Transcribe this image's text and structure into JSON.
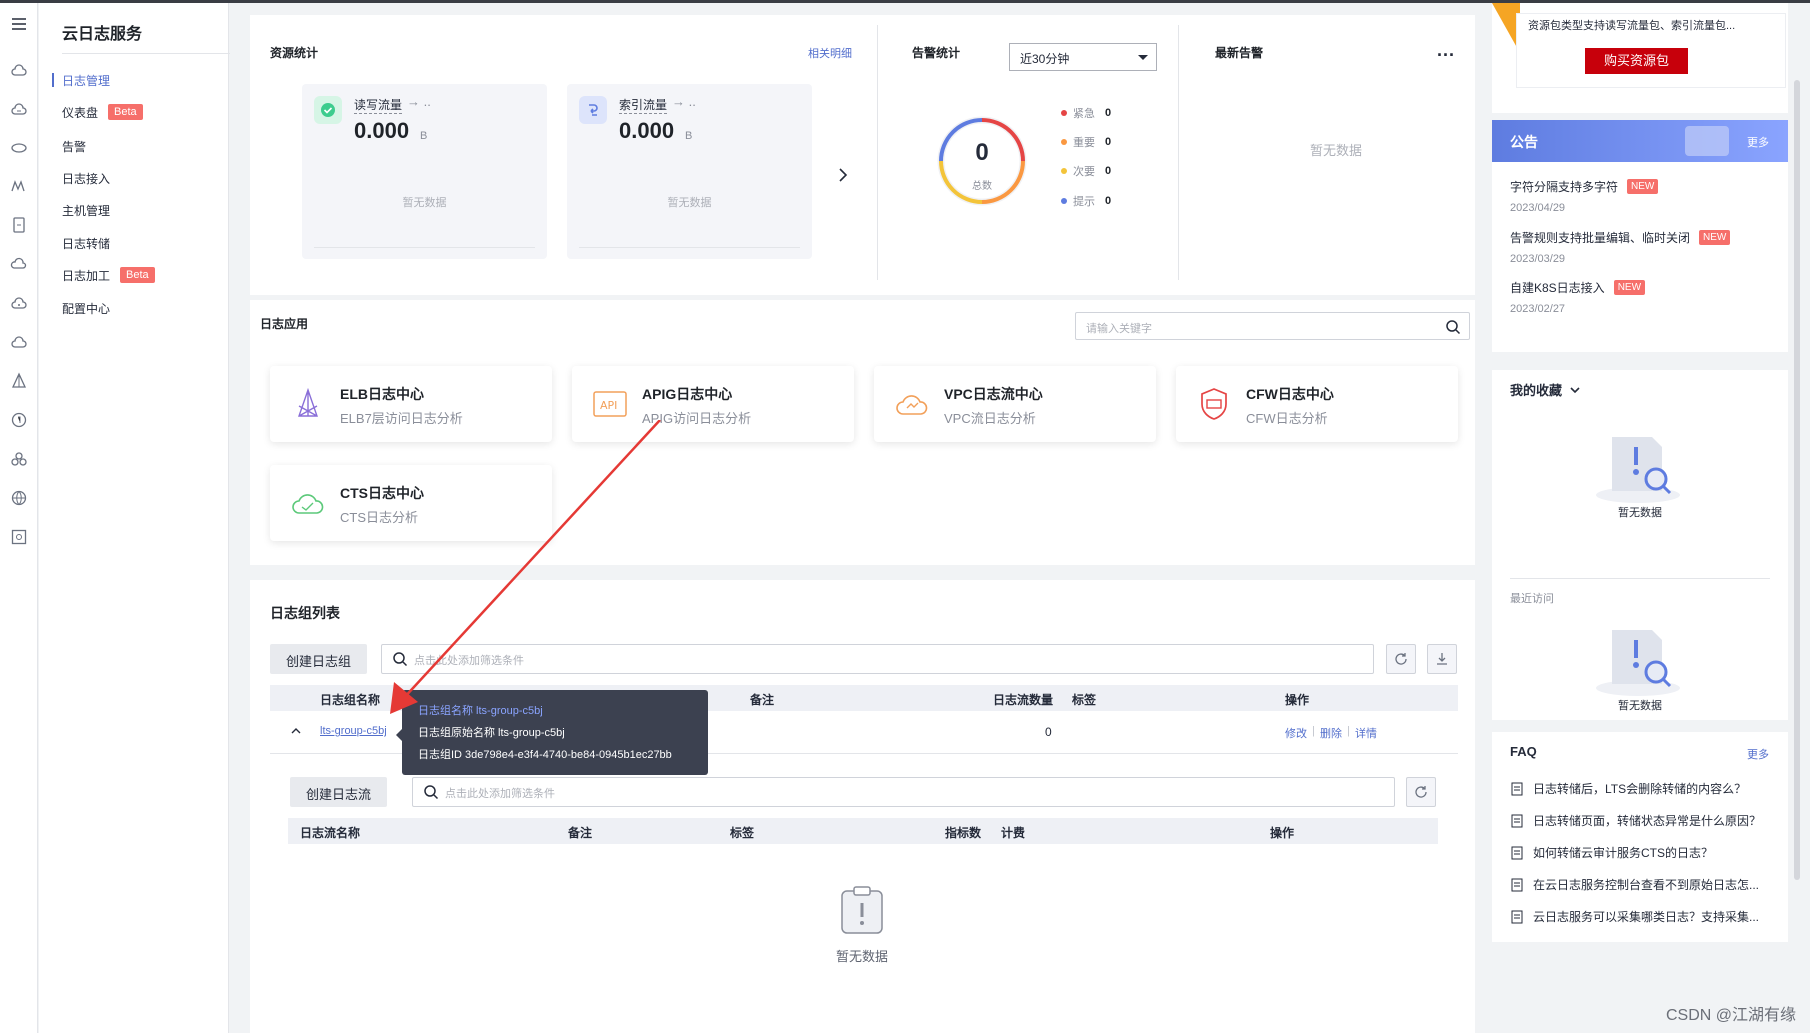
{
  "menu": {
    "title": "云日志服务",
    "items": [
      {
        "label": "日志管理",
        "active": true
      },
      {
        "label": "仪表盘",
        "badge": "Beta"
      },
      {
        "label": "告警"
      },
      {
        "label": "日志接入"
      },
      {
        "label": "主机管理"
      },
      {
        "label": "日志转储"
      },
      {
        "label": "日志加工",
        "badge": "Beta"
      },
      {
        "label": "配置中心"
      }
    ]
  },
  "resource": {
    "title": "资源统计",
    "link": "相关明细",
    "cards": [
      {
        "label": "读写流量",
        "arrow": "→ ..",
        "value": "0.000",
        "unit": "B",
        "empty": "暂无数据"
      },
      {
        "label": "索引流量",
        "arrow": "→ ..",
        "value": "0.000",
        "unit": "B",
        "empty": "暂无数据"
      }
    ]
  },
  "alarm_stats": {
    "title": "告警统计",
    "range": "近30分钟",
    "total": "0",
    "total_label": "总数",
    "levels": [
      {
        "name": "紧急",
        "count": "0",
        "color": "#e54545"
      },
      {
        "name": "重要",
        "count": "0",
        "color": "#fa9841"
      },
      {
        "name": "次要",
        "count": "0",
        "color": "#f3c43a"
      },
      {
        "name": "提示",
        "count": "0",
        "color": "#5e7ce0"
      }
    ]
  },
  "latest_alarm": {
    "title": "最新告警",
    "more": "...",
    "empty": "暂无数据"
  },
  "apps": {
    "title": "日志应用",
    "search_placeholder": "请输入关键字",
    "items": [
      {
        "name": "ELB日志中心",
        "desc": "ELB7层访问日志分析",
        "icon": "elb-icon"
      },
      {
        "name": "APIG日志中心",
        "desc": "APIG访问日志分析",
        "icon": "apig-icon"
      },
      {
        "name": "VPC日志流中心",
        "desc": "VPC流日志分析",
        "icon": "vpc-icon"
      },
      {
        "name": "CFW日志中心",
        "desc": "CFW日志分析",
        "icon": "cfw-icon"
      },
      {
        "name": "CTS日志中心",
        "desc": "CTS日志分析",
        "icon": "cts-icon"
      }
    ]
  },
  "loggroups": {
    "title": "日志组列表",
    "create_button": "创建日志组",
    "filter_placeholder": "点击此处添加筛选条件",
    "columns": [
      "日志组名称",
      "备注",
      "日志流数量",
      "标签",
      "操作"
    ],
    "rows": [
      {
        "name": "lts-group-c5bj",
        "stream_count": "0",
        "actions": [
          "修改",
          "删除",
          "详情"
        ]
      }
    ],
    "tooltip": {
      "line1": "日志组名称 lts-group-c5bj",
      "line2": "日志组原始名称 lts-group-c5bj",
      "line3": "日志组ID 3de798e4-e3f4-4740-be84-0945b1ec27bb"
    }
  },
  "logstreams": {
    "create_button": "创建日志流",
    "filter_placeholder": "点击此处添加筛选条件",
    "columns": [
      "日志流名称",
      "备注",
      "标签",
      "指标数",
      "计费",
      "操作"
    ],
    "empty": "暂无数据"
  },
  "promo": {
    "text": "资源包类型支持读写流量包、索引流量包...",
    "button": "购买资源包"
  },
  "notice": {
    "title": "公告",
    "more": "更多",
    "items": [
      {
        "title": "字符分隔支持多字符",
        "badge": "NEW",
        "date": "2023/04/29"
      },
      {
        "title": "告警规则支持批量编辑、临时关闭",
        "badge": "NEW",
        "date": "2023/03/29"
      },
      {
        "title": "自建K8S日志接入",
        "badge": "NEW",
        "date": "2023/02/27"
      }
    ]
  },
  "favorites": {
    "title": "我的收藏",
    "empty": "暂无数据",
    "recent_title": "最近访问",
    "recent_empty": "暂无数据"
  },
  "faq": {
    "title": "FAQ",
    "more": "更多",
    "items": [
      "日志转储后，LTS会删除转储的内容么？",
      "日志转储页面，转储状态异常是什么原因？",
      "如何转储云审计服务CTS的日志？",
      "在云日志服务控制台查看不到原始日志怎...",
      "云日志服务可以采集哪类日志？支持采集..."
    ]
  },
  "watermark": "CSDN @江湖有缘"
}
